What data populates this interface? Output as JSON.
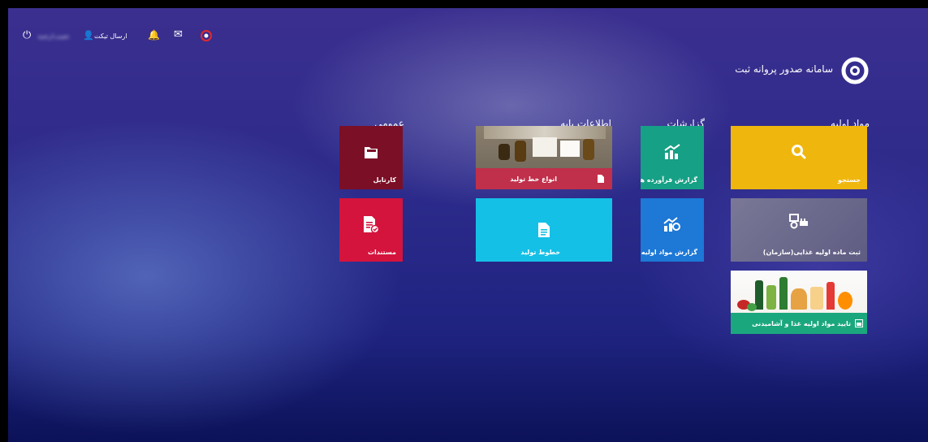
{
  "header": {
    "app_title": "سامانه صدور پروانه ثبت",
    "ticket_label": "ارسال تیکت",
    "user_name": "نصیب/رشید",
    "org_name": "..."
  },
  "sections": {
    "raw_materials": "مواد اولیه",
    "reports": "گزارشات",
    "base_info": "اطلاعات پایه",
    "general": "عمومی"
  },
  "tiles": {
    "search": "جستجو",
    "register_raw_food": "ثبت ماده اولیه غذایی(سازمان)",
    "approve_raw": "تایید مواد اولیه غذا و آشامیدنی",
    "report_products": "گزارش فرآورده ها",
    "report_raw": "گزارش مواد اولیه",
    "production_line_types": "انواع خط تولید",
    "production_lines": "خطوط تولید",
    "cartable": "کارتابل",
    "documents": "مستندات"
  },
  "colors": {
    "search_tile": "#efb60e",
    "register_tile": "#6b6a8e",
    "approve_bar": "#1ba77e",
    "report_green": "#16a085",
    "report_blue": "#1d78d6",
    "line_types_bar": "#c0304a",
    "lines_tile": "#15c0e6",
    "cartable_tile": "#7b0f26",
    "documents_tile": "#d4143d"
  }
}
